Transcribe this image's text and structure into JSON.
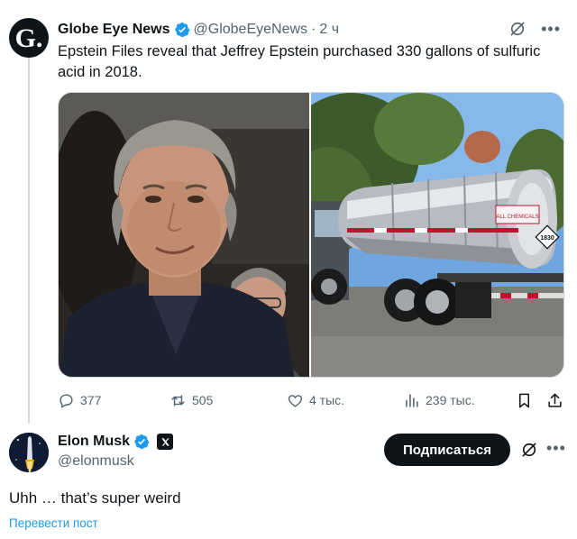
{
  "tweet": {
    "avatar_letter": "G.",
    "author_name": "Globe Eye News",
    "author_handle": "@GlobeEyeNews",
    "separator": "·",
    "time": "2 ч",
    "text": "Epstein Files reveal that Jeffrey Epstein purchased 330 gallons of sulfuric acid in 2018.",
    "media": {
      "left_image": "portrait-photo",
      "right_image": "tanker-truck-photo",
      "sign_text": "1830",
      "tank_label": "ALL CHEMICALS"
    },
    "stats": {
      "replies": "377",
      "reposts": "505",
      "likes": "4 тыс.",
      "views": "239 тыс."
    }
  },
  "reply": {
    "author_name": "Elon Musk",
    "author_handle": "@elonmusk",
    "follow_label": "Подписаться",
    "text": "Uhh … that’s super weird",
    "translate_label": "Перевести пост"
  },
  "colors": {
    "accent": "#1d9bf0",
    "text_primary": "#0f1419",
    "text_secondary": "#536471",
    "divider": "#cfd9de"
  },
  "icons": {
    "verified": "verified-badge-icon",
    "grok": "grok-icon",
    "more": "more-icon",
    "reply": "reply-icon",
    "repost": "repost-icon",
    "like": "heart-icon",
    "views": "views-icon",
    "bookmark": "bookmark-icon",
    "share": "share-icon",
    "x_affiliation": "x-logo-icon"
  }
}
